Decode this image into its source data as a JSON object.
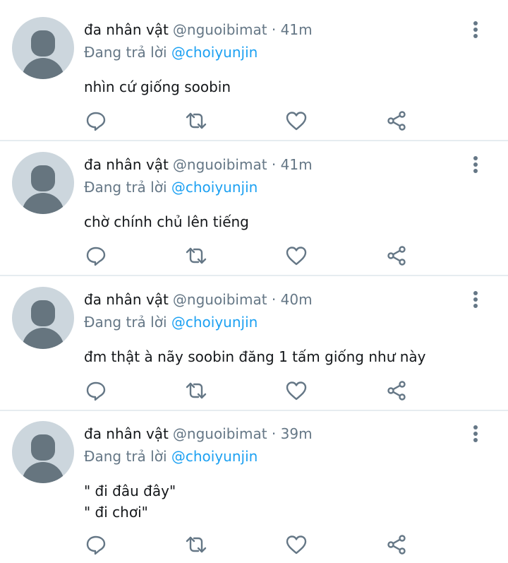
{
  "tweets": [
    {
      "name": "đa nhân vật",
      "handle": "@nguoibimat",
      "dot": "·",
      "time": "41m",
      "reply_prefix": "Đang trả lời",
      "reply_to": "@choiyunjin",
      "lines": [
        "nhìn cứ giống soobin"
      ]
    },
    {
      "name": "đa nhân vật",
      "handle": "@nguoibimat",
      "dot": "·",
      "time": "41m",
      "reply_prefix": "Đang trả lời",
      "reply_to": "@choiyunjin",
      "lines": [
        "chờ chính chủ lên tiếng"
      ]
    },
    {
      "name": "đa nhân vật",
      "handle": "@nguoibimat",
      "dot": "·",
      "time": "40m",
      "reply_prefix": "Đang trả lời",
      "reply_to": "@choiyunjin",
      "lines": [
        "đm thật à nãy soobin đăng 1 tấm giống như này"
      ]
    },
    {
      "name": "đa nhân vật",
      "handle": "@nguoibimat",
      "dot": "·",
      "time": "39m",
      "reply_prefix": "Đang trả lời",
      "reply_to": "@choiyunjin",
      "lines": [
        "\" đi đâu đây\"",
        "\" đi chơi\""
      ]
    }
  ],
  "icons": {
    "avatar": "default-avatar",
    "more": "more-vertical-icon",
    "reply": "reply-icon",
    "retweet": "retweet-icon",
    "like": "like-heart-icon",
    "share": "share-icon"
  },
  "colors": {
    "text": "#14171a",
    "secondary": "#657786",
    "mention": "#1da1f2",
    "divider": "#e6ecf0",
    "avatar_bg": "#ccd6dd",
    "avatar_fg": "#66757f"
  }
}
